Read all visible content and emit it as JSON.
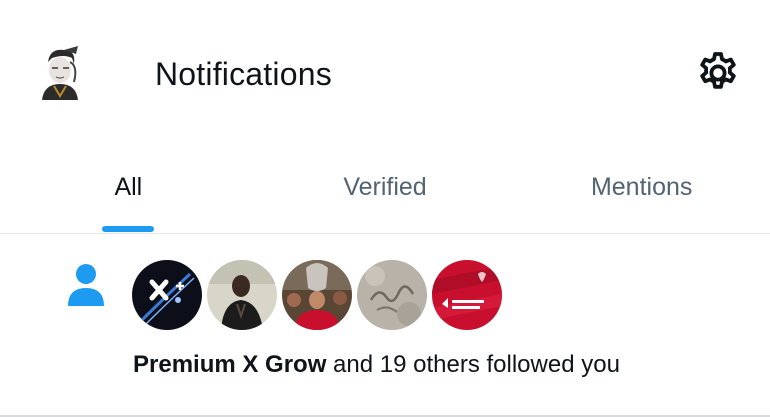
{
  "header": {
    "title": "Notifications",
    "avatar_icon": "profile-avatar",
    "settings_icon": "gear-icon"
  },
  "tabs": [
    {
      "label": "All",
      "active": true
    },
    {
      "label": "Verified",
      "active": false
    },
    {
      "label": "Mentions",
      "active": false
    }
  ],
  "notification": {
    "type_icon": "person-icon",
    "name": "Premium X Grow",
    "rest": " and 19 others followed you",
    "avatars": [
      "premium-x-grow-avatar",
      "follower-avatar-2",
      "follower-avatar-3",
      "follower-avatar-4",
      "follower-avatar-5"
    ]
  },
  "colors": {
    "accent": "#1d9bf0",
    "text_primary": "#0f1419",
    "text_secondary": "#536471",
    "divider": "#e6e9eb"
  }
}
